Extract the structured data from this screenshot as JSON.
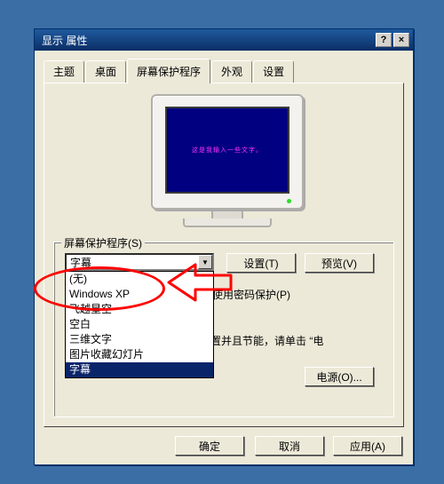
{
  "title": "显示 属性",
  "titlebar": {
    "help": "?",
    "close": "×"
  },
  "tabs": {
    "theme": "主题",
    "desktop": "桌面",
    "scrsaver": "屏幕保护程序",
    "appearance": "外观",
    "settings": "设置"
  },
  "screensaver": {
    "preview_text": "这是我输入一些文字。",
    "group_label": "屏幕保护程序(S)",
    "selected": "字幕",
    "options": [
      "(无)",
      "Windows XP",
      "飞越星空",
      "空白",
      "三维文字",
      "图片收藏幻灯片",
      "字幕"
    ],
    "settings_btn": "设置(T)",
    "preview_btn": "预览(V)",
    "wait_label": "在恢复时使用密码保护(P)",
    "hint": "电源设置并且节能，请单击 “电",
    "power_btn": "电源(O)..."
  },
  "dialog_buttons": {
    "ok": "确定",
    "cancel": "取消",
    "apply": "应用(A)"
  }
}
